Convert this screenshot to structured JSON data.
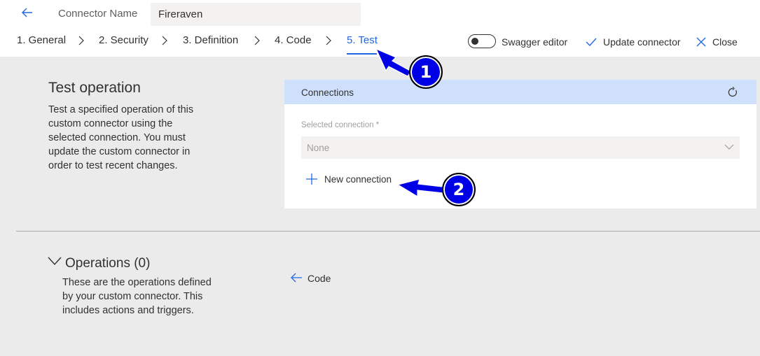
{
  "header": {
    "name_label": "Connector Name",
    "name_value": "Fireraven"
  },
  "tabs": [
    {
      "label": "1. General"
    },
    {
      "label": "2. Security"
    },
    {
      "label": "3. Definition"
    },
    {
      "label": "4. Code"
    },
    {
      "label": "5. Test",
      "active": true
    }
  ],
  "commands": {
    "swagger_label": "Swagger editor",
    "swagger_on": false,
    "update_label": "Update connector",
    "close_label": "Close"
  },
  "test_operation": {
    "title": "Test operation",
    "description": "Test a specified operation of this custom connector using the selected connection. You must update the custom connector in order to test recent changes."
  },
  "connections": {
    "title": "Connections",
    "field_label": "Selected connection *",
    "selected_value": "None",
    "new_connection_label": "New connection"
  },
  "operations": {
    "title": "Operations (0)",
    "description": "These are the operations defined by your custom connector. This includes actions and triggers.",
    "code_link_label": "Code"
  },
  "callouts": [
    {
      "number": "1"
    },
    {
      "number": "2"
    }
  ],
  "colors": {
    "accent": "#2266e3",
    "callout": "#0000e6",
    "card_header": "#cfe0fc",
    "content_bg": "#ebebeb"
  }
}
